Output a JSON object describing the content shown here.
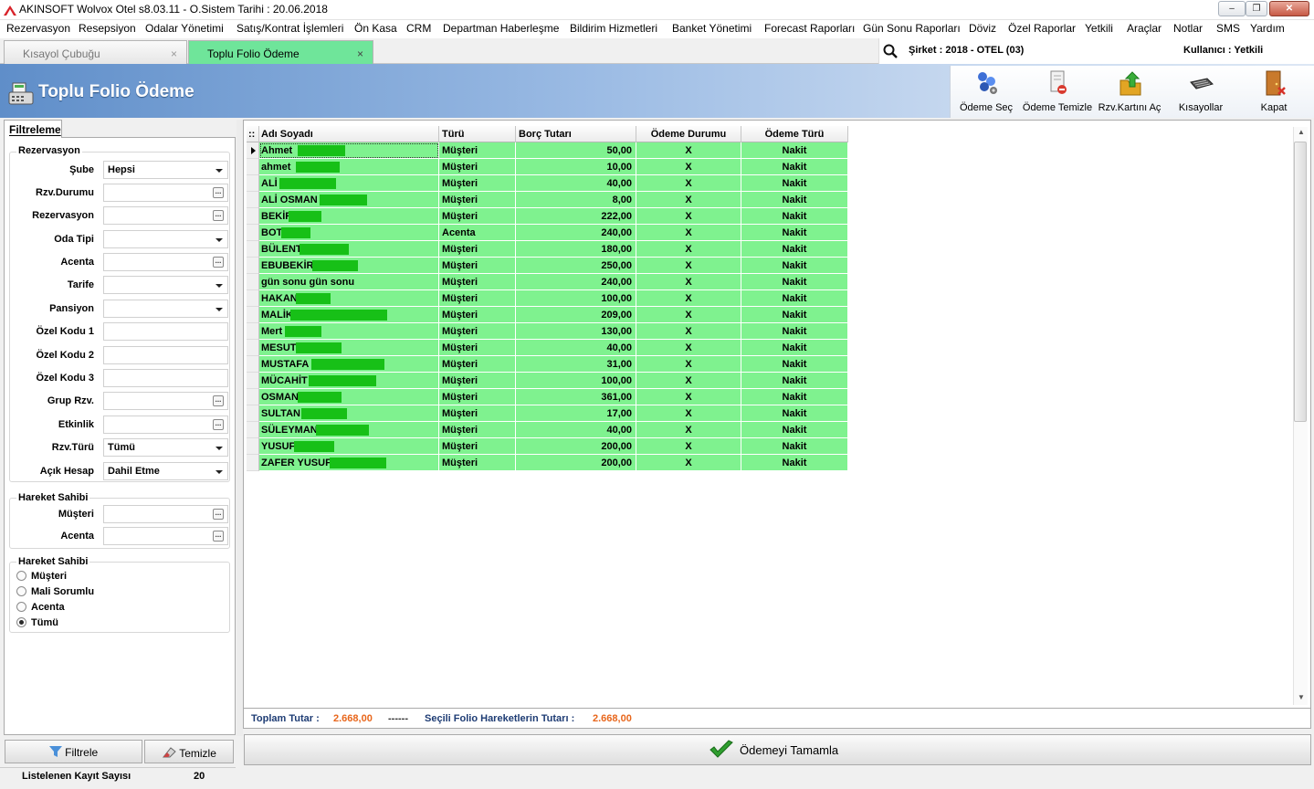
{
  "window": {
    "title": "AKINSOFT Wolvox Otel s8.03.11 - O.Sistem Tarihi : 20.06.2018",
    "buttons": {
      "minimize": "–",
      "restore": "❐",
      "close": "✕"
    }
  },
  "menu": [
    "Rezervasyon",
    "Resepsiyon",
    "Odalar Yönetimi",
    "Satış/Kontrat İşlemleri",
    "Ön Kasa",
    "CRM",
    "Departman Haberleşme",
    "Bildirim Hizmetleri",
    "Banket Yönetimi",
    "Forecast Raporları",
    "Gün Sonu Raporları",
    "Döviz",
    "Özel Raporlar",
    "Yetkili",
    "Araçlar",
    "Notlar",
    "SMS",
    "Yardım"
  ],
  "tabs": [
    {
      "label": "Kısayol Çubuğu",
      "close": "×"
    },
    {
      "label": "Toplu Folio Ödeme",
      "close": "×"
    }
  ],
  "company": {
    "sirket": "Şirket : 2018 - OTEL (03)",
    "kullanici": "Kullanıcı : Yetkili"
  },
  "page_title": "Toplu Folio Ödeme",
  "toolbar": [
    {
      "label": "Ödeme Seç",
      "icon": "odeme-sec-icon"
    },
    {
      "label": "Ödeme Temizle",
      "icon": "odeme-temizle-icon"
    },
    {
      "label": "Rzv.Kartını Aç",
      "icon": "open-card-icon"
    },
    {
      "label": "Kısayollar",
      "icon": "keyboard-icon"
    },
    {
      "label": "Kapat",
      "icon": "door-close-icon"
    }
  ],
  "filter": {
    "tab_label": "Filtreleme",
    "group_rezervasyon": "Rezervasyon",
    "fields": [
      {
        "label": "Şube",
        "value": "Hepsi",
        "kind": "dropdown"
      },
      {
        "label": "Rzv.Durumu",
        "value": "",
        "kind": "ellipsis"
      },
      {
        "label": "Rezervasyon",
        "value": "",
        "kind": "ellipsis"
      },
      {
        "label": "Oda Tipi",
        "value": "",
        "kind": "dropdown"
      },
      {
        "label": "Acenta",
        "value": "",
        "kind": "ellipsis"
      },
      {
        "label": "Tarife",
        "value": "",
        "kind": "dropdown"
      },
      {
        "label": "Pansiyon",
        "value": "",
        "kind": "dropdown"
      },
      {
        "label": "Özel Kodu 1",
        "value": "",
        "kind": "text"
      },
      {
        "label": "Özel Kodu 2",
        "value": "",
        "kind": "text"
      },
      {
        "label": "Özel Kodu 3",
        "value": "",
        "kind": "text"
      },
      {
        "label": "Grup Rzv.",
        "value": "",
        "kind": "ellipsis"
      },
      {
        "label": "Etkinlik",
        "value": "",
        "kind": "ellipsis"
      },
      {
        "label": "Rzv.Türü",
        "value": "Tümü",
        "kind": "dropdown"
      },
      {
        "label": "Açık Hesap",
        "value": "Dahil Etme",
        "kind": "dropdown"
      }
    ],
    "group_hareket1": "Hareket Sahibi",
    "hareket_fields": [
      {
        "label": "Müşteri",
        "value": ""
      },
      {
        "label": "Acenta",
        "value": ""
      }
    ],
    "group_hareket2": "Hareket Sahibi",
    "radios": [
      {
        "label": "Müşteri",
        "checked": false
      },
      {
        "label": "Mali Sorumlu",
        "checked": false
      },
      {
        "label": "Acenta",
        "checked": false
      },
      {
        "label": "Tümü",
        "checked": true
      }
    ],
    "filtrele_label": "Filtrele",
    "temizle_label": "Temizle",
    "ellipsis": "..."
  },
  "status": {
    "label": "Listelenen Kayıt Sayısı",
    "count": "20"
  },
  "grid": {
    "drag_handle": "::",
    "columns": [
      "Adı Soyadı",
      "Türü",
      "Borç Tutarı",
      "Ödeme Durumu",
      "Ödeme Türü"
    ],
    "rows": [
      {
        "name": "Ahmet",
        "type": "Müşteri",
        "amount": "50,00",
        "status": "X",
        "ptype": "Nakit"
      },
      {
        "name": "ahmet",
        "type": "Müşteri",
        "amount": "10,00",
        "status": "X",
        "ptype": "Nakit"
      },
      {
        "name": "ALİ",
        "type": "Müşteri",
        "amount": "40,00",
        "status": "X",
        "ptype": "Nakit"
      },
      {
        "name": "ALİ OSMAN",
        "type": "Müşteri",
        "amount": "8,00",
        "status": "X",
        "ptype": "Nakit"
      },
      {
        "name": "BEKİR",
        "type": "Müşteri",
        "amount": "222,00",
        "status": "X",
        "ptype": "Nakit"
      },
      {
        "name": "BOT",
        "type": "Acenta",
        "amount": "240,00",
        "status": "X",
        "ptype": "Nakit"
      },
      {
        "name": "BÜLENT",
        "type": "Müşteri",
        "amount": "180,00",
        "status": "X",
        "ptype": "Nakit"
      },
      {
        "name": "EBUBEKİR",
        "type": "Müşteri",
        "amount": "250,00",
        "status": "X",
        "ptype": "Nakit"
      },
      {
        "name": "gün sonu gün sonu",
        "type": "Müşteri",
        "amount": "240,00",
        "status": "X",
        "ptype": "Nakit"
      },
      {
        "name": "HAKAN",
        "type": "Müşteri",
        "amount": "100,00",
        "status": "X",
        "ptype": "Nakit"
      },
      {
        "name": "MALİK",
        "type": "Müşteri",
        "amount": "209,00",
        "status": "X",
        "ptype": "Nakit"
      },
      {
        "name": "Mert",
        "type": "Müşteri",
        "amount": "130,00",
        "status": "X",
        "ptype": "Nakit"
      },
      {
        "name": "MESUT",
        "type": "Müşteri",
        "amount": "40,00",
        "status": "X",
        "ptype": "Nakit"
      },
      {
        "name": "MUSTAFA",
        "type": "Müşteri",
        "amount": "31,00",
        "status": "X",
        "ptype": "Nakit"
      },
      {
        "name": "MÜCAHİT",
        "type": "Müşteri",
        "amount": "100,00",
        "status": "X",
        "ptype": "Nakit"
      },
      {
        "name": "OSMAN",
        "type": "Müşteri",
        "amount": "361,00",
        "status": "X",
        "ptype": "Nakit"
      },
      {
        "name": "SULTAN",
        "type": "Müşteri",
        "amount": "17,00",
        "status": "X",
        "ptype": "Nakit"
      },
      {
        "name": "SÜLEYMAN",
        "type": "Müşteri",
        "amount": "40,00",
        "status": "X",
        "ptype": "Nakit"
      },
      {
        "name": "YUSUF",
        "type": "Müşteri",
        "amount": "200,00",
        "status": "X",
        "ptype": "Nakit"
      },
      {
        "name": "ZAFER YUSUF",
        "type": "Müşteri",
        "amount": "200,00",
        "status": "X",
        "ptype": "Nakit"
      }
    ]
  },
  "totals": {
    "toplam_label": "Toplam Tutar :",
    "toplam_value": "2.668,00",
    "separator": "------",
    "secili_label": "Seçili Folio Hareketlerin Tutarı :",
    "secili_value": "2.668,00"
  },
  "complete_button": "Ödemeyi Tamamla",
  "colors": {
    "row_green": "#7ff28f",
    "redaction_green": "#17c017",
    "active_tab": "#6fe59a",
    "total_value": "#e8661b"
  }
}
